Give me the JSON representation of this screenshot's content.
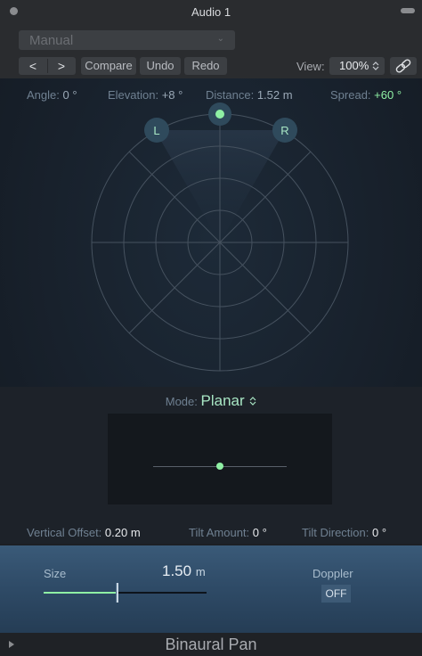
{
  "window": {
    "title": "Audio 1"
  },
  "preset": {
    "value": "Manual"
  },
  "toolbar": {
    "back": "<",
    "forward": ">",
    "compare": "Compare",
    "undo": "Undo",
    "redo": "Redo",
    "view_label": "View:",
    "view_value": "100%"
  },
  "readouts": {
    "angle_label": "Angle:",
    "angle_value": "0 °",
    "elevation_label": "Elevation:",
    "elevation_value": "+8 °",
    "distance_label": "Distance:",
    "distance_value": "1.52 m",
    "spread_label": "Spread:",
    "spread_value": "+60 °"
  },
  "pan": {
    "left_channel": "L",
    "right_channel": "R"
  },
  "mode": {
    "label": "Mode:",
    "value": "Planar"
  },
  "bottom": {
    "vertical_offset_label": "Vertical Offset:",
    "vertical_offset_value": "0.20 m",
    "tilt_amount_label": "Tilt Amount:",
    "tilt_amount_value": "0 °",
    "tilt_direction_label": "Tilt Direction:",
    "tilt_direction_value": "0 °"
  },
  "size": {
    "label": "Size",
    "value": "1.50",
    "unit": "m",
    "slider_fraction": 0.45
  },
  "doppler": {
    "label": "Doppler",
    "value": "OFF"
  },
  "footer": {
    "plugin_name": "Binaural Pan"
  },
  "colors": {
    "accent": "#8ff0a4",
    "panel_blue": "#2e4a66"
  },
  "icons": {
    "view_stepper": "updown-chevron-icon",
    "link": "link-icon",
    "expand": "triangle-right-icon"
  }
}
